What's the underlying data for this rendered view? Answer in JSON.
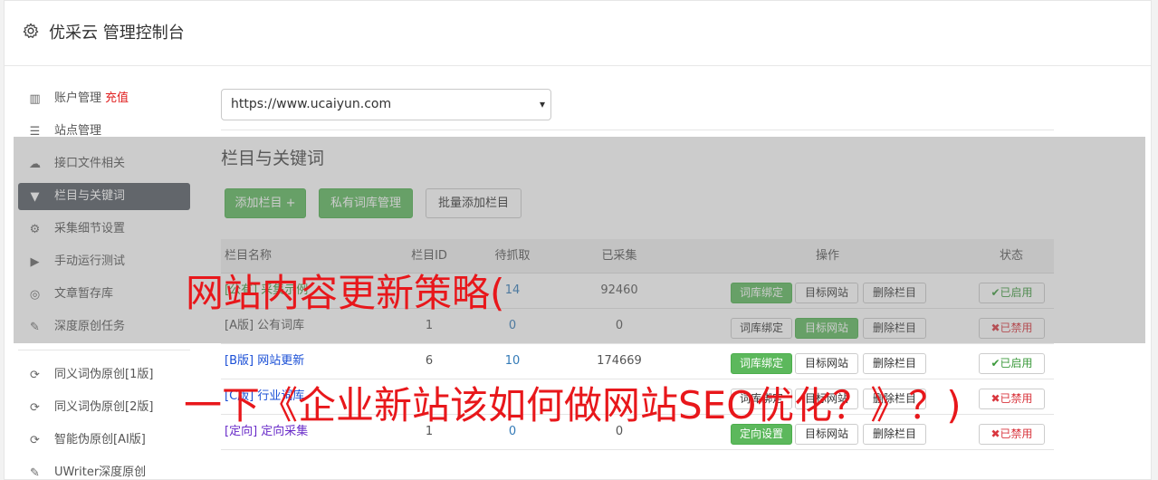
{
  "header": {
    "title": "优采云 管理控制台"
  },
  "sidebar": {
    "items": [
      {
        "label": "账户管理",
        "extra": "充值",
        "icon": "bar-chart-icon"
      },
      {
        "label": "站点管理",
        "icon": "server-icon"
      },
      {
        "label": "接口文件相关",
        "icon": "cloud-upload-icon"
      },
      {
        "label": "栏目与关键词",
        "icon": "filter-icon"
      },
      {
        "label": "采集细节设置",
        "icon": "gears-icon"
      },
      {
        "label": "手动运行测试",
        "icon": "play-circle-icon"
      },
      {
        "label": "文章暂存库",
        "icon": "database-icon"
      },
      {
        "label": "深度原创任务",
        "icon": "edit-icon"
      }
    ],
    "items2": [
      {
        "label": "同义词伪原创[1版]",
        "icon": "refresh-icon"
      },
      {
        "label": "同义词伪原创[2版]",
        "icon": "refresh-icon"
      },
      {
        "label": "智能伪原创[AI版]",
        "icon": "refresh-icon"
      },
      {
        "label": "UWriter深度原创",
        "icon": "edit-icon"
      }
    ]
  },
  "main": {
    "site_select": "https://www.ucaiyun.com",
    "section_title": "栏目与关键词",
    "buttons": {
      "add_column": "添加栏目 +",
      "private_lib": "私有词库管理",
      "batch_add": "批量添加栏目"
    },
    "table": {
      "headers": {
        "name": "栏目名称",
        "id": "栏目ID",
        "pending": "待抓取",
        "collected": "已采集",
        "ops": "操作",
        "status": "状态"
      },
      "rows": [
        {
          "name": "[公有] 采集示例",
          "id": "",
          "pending": "14",
          "collected": "92460",
          "op1": "词库绑定",
          "op2": "目标网站",
          "op3": "删除栏目",
          "status": "已启用"
        },
        {
          "name": "[A版] 公有词库",
          "id": "1",
          "pending": "0",
          "collected": "0",
          "op1": "词库绑定",
          "op2": "目标网站",
          "op3": "删除栏目",
          "status": "已禁用"
        },
        {
          "name": "[B版] 网站更新",
          "id": "6",
          "pending": "10",
          "collected": "174669",
          "op1": "词库绑定",
          "op2": "目标网站",
          "op3": "删除栏目",
          "status": "已启用"
        },
        {
          "name": "[C版] 行业词库",
          "id": "",
          "pending": "",
          "collected": "",
          "op1": "词库绑定",
          "op2": "目标网站",
          "op3": "删除栏目",
          "status": "已禁用"
        },
        {
          "name": "[定向] 定向采集",
          "id": "1",
          "pending": "0",
          "collected": "0",
          "op1": "定向设置",
          "op2": "目标网站",
          "op3": "删除栏目",
          "status": "已禁用"
        }
      ]
    }
  },
  "watermark": {
    "line1": "网站内容更新策略(",
    "line2": "一下《企业新站该如何做网站SEO优化？》？)"
  },
  "colors": {
    "green": "#5cb85c",
    "active_nav": "#555b63",
    "watermark": "#e8171b",
    "link_blue": "#337ab7"
  }
}
